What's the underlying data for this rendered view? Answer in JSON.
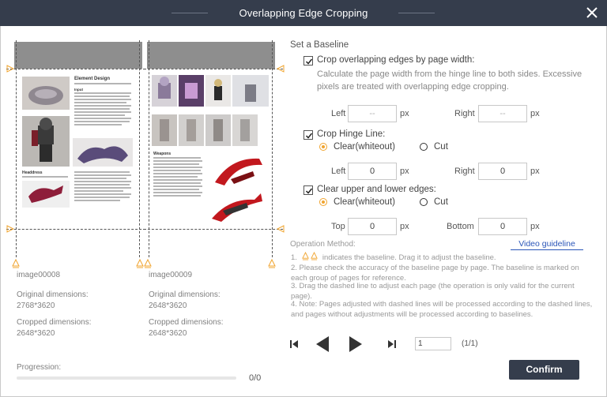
{
  "window": {
    "title": "Overlapping Edge Cropping"
  },
  "pages": [
    {
      "name": "image00008",
      "original_label": "Original dimensions:",
      "original_value": "2768*3620",
      "cropped_label": "Cropped dimensions:",
      "cropped_value": "2648*3620",
      "heading_1": "Element Design",
      "heading_2": "Headdress",
      "heading_3": "Input"
    },
    {
      "name": "image00009",
      "original_label": "Original dimensions:",
      "original_value": "2648*3620",
      "cropped_label": "Cropped dimensions:",
      "cropped_value": "2648*3620",
      "heading_1": "Weapons"
    }
  ],
  "progress": {
    "label": "Progression:",
    "value": 0,
    "text": "0/0"
  },
  "settings": {
    "section_title": "Set a Baseline",
    "crop_width": {
      "label": "Crop overlapping edges by page width:",
      "checked": true,
      "description": "Calculate the page width from the hinge line to both sides. Excessive pixels are treated with overlapping edge cropping.",
      "left_label": "Left",
      "left_value": "--",
      "right_label": "Right",
      "right_value": "--",
      "unit": "px"
    },
    "hinge": {
      "label": "Crop Hinge Line:",
      "checked": true,
      "option_clear": "Clear(whiteout)",
      "option_cut": "Cut",
      "selected": "Clear(whiteout)",
      "left_label": "Left",
      "left_value": "0",
      "right_label": "Right",
      "right_value": "0",
      "unit": "px"
    },
    "edges": {
      "label": "Clear upper and lower edges:",
      "checked": true,
      "option_clear": "Clear(whiteout)",
      "option_cut": "Cut",
      "selected": "Clear(whiteout)",
      "top_label": "Top",
      "top_value": "0",
      "bottom_label": "Bottom",
      "bottom_value": "0",
      "unit": "px"
    }
  },
  "operation": {
    "title": "Operation Method:",
    "video_link": "Video guideline",
    "step1_prefix": "1.",
    "step1_text": "indicates the baseline. Drag it to adjust the baseline.",
    "step2": "2. Please check the accuracy of the baseline page by page. The baseline is marked on each group of pages for reference.",
    "step3": "3. Drag the dashed line to adjust each page (the operation is only valid for the current page).",
    "step4": "4. Note: Pages adjusted with dashed lines will be processed according to the dashed lines, and pages without adjustments will be processed according to baselines."
  },
  "pagination": {
    "current": "1",
    "count": "(1/1)"
  },
  "confirm_label": "Confirm",
  "colors": {
    "titlebar": "#353d4c",
    "accent": "#f0a42f",
    "link": "#2a55b8",
    "page_margin": "#8e8e8e"
  }
}
